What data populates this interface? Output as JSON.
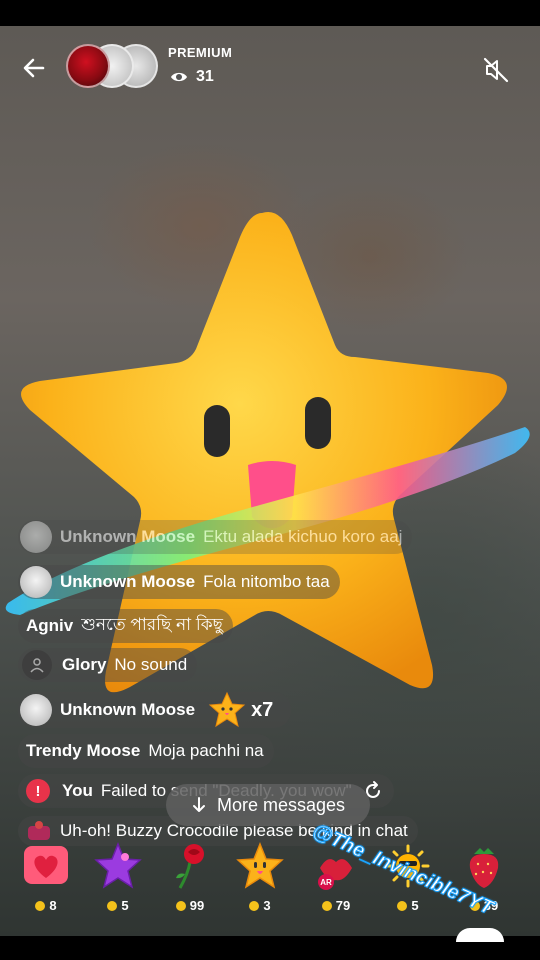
{
  "header": {
    "premium_label": "PREMIUM",
    "viewer_count": "31"
  },
  "chat": {
    "messages": [
      {
        "name": "Unknown Moose",
        "text": "Ektu alada kichuo koro aaj"
      },
      {
        "name": "Unknown Moose",
        "text": "Fola nitombo taa"
      },
      {
        "name": "Agniv",
        "text": "শুনতে পারছি না কিছু"
      },
      {
        "name": "Glory",
        "text": "No sound"
      },
      {
        "name": "Unknown Moose",
        "text": "x7"
      },
      {
        "name": "Trendy Moose",
        "text": "Moja pachhi na"
      },
      {
        "name": "You",
        "text": "Failed to send \"Deadly. you wow\""
      },
      {
        "name": "",
        "text": "Uh-oh! Buzzy Crocodile please be kind in chat"
      }
    ],
    "more_label": "More messages"
  },
  "gifts": [
    {
      "icon": "heart-gift-icon",
      "price": "8"
    },
    {
      "icon": "purple-star-gift-icon",
      "price": "5"
    },
    {
      "icon": "rose-gift-icon",
      "price": "99"
    },
    {
      "icon": "star-gift-icon",
      "price": "3"
    },
    {
      "icon": "lips-gift-icon",
      "price": "79"
    },
    {
      "icon": "sun-gift-icon",
      "price": "5"
    },
    {
      "icon": "strawberry-gift-icon",
      "price": "39"
    }
  ],
  "gift_badge": "AR",
  "watermark": "@The_Invincible7YT",
  "colors": {
    "accent_error": "#e8334a",
    "coin": "#f4c21b",
    "watermark_stroke": "#1aa3ff"
  }
}
